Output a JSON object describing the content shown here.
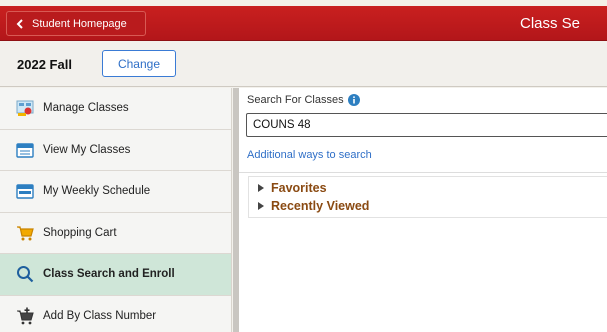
{
  "header": {
    "back_button_label": "Student Homepage",
    "page_title": "Class Se"
  },
  "term": {
    "label": "2022 Fall",
    "change_label": "Change"
  },
  "sidebar": {
    "items": [
      {
        "label": "Manage Classes",
        "icon": "manage-classes-icon"
      },
      {
        "label": "View My Classes",
        "icon": "calendar-icon"
      },
      {
        "label": "My Weekly Schedule",
        "icon": "calendar-icon"
      },
      {
        "label": "Shopping Cart",
        "icon": "shopping-cart-icon"
      },
      {
        "label": "Class Search and Enroll",
        "icon": "search-icon",
        "active": true
      },
      {
        "label": "Add By Class Number",
        "icon": "add-to-cart-icon"
      }
    ]
  },
  "search": {
    "label": "Search For Classes",
    "value": "COUNS 48",
    "additional_ways_link": "Additional ways to search"
  },
  "sections": {
    "favorites": "Favorites",
    "recently_viewed": "Recently Viewed"
  },
  "colors": {
    "banner": "#c01b1e",
    "active_nav": "#cfe6d8",
    "link": "#2f6fc7",
    "section_title": "#8a4a12"
  }
}
